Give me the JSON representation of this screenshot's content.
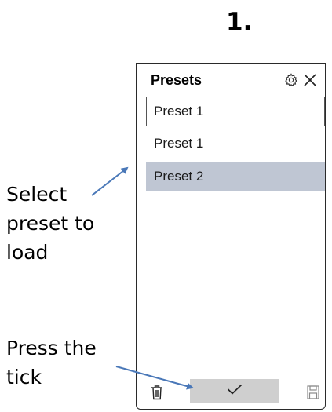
{
  "step_label": "1.",
  "annotations": {
    "select_note_lines": [
      "Select",
      "preset to",
      "load"
    ],
    "tick_note_lines": [
      "Press the",
      "tick"
    ],
    "arrow_color": "#4a78b8"
  },
  "panel": {
    "title": "Presets",
    "header_icons": [
      "gear-icon",
      "close-icon"
    ],
    "name_input_value": "Preset 1",
    "presets": [
      "Preset 1",
      "Preset 2"
    ],
    "selected_preset": "Preset 2",
    "selected_color": "#bfc6d3",
    "footer_icons": [
      "trash-icon",
      "checkmark-icon",
      "save-icon"
    ]
  }
}
